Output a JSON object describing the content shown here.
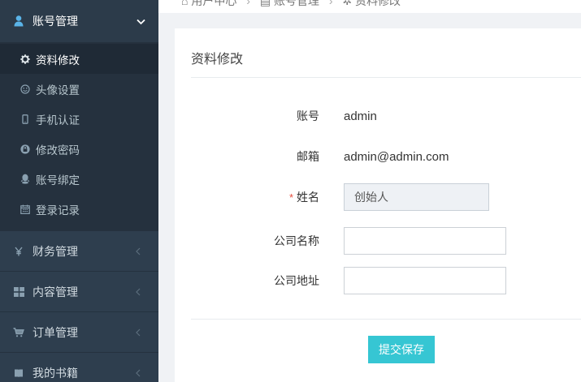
{
  "breadcrumb": {
    "items": [
      "用户中心",
      "账号管理",
      "资料修改"
    ]
  },
  "sidebar": {
    "account": {
      "label": "账号管理",
      "items": [
        {
          "label": "资料修改",
          "icon": "gear-icon",
          "active": true
        },
        {
          "label": "头像设置",
          "icon": "smile-icon"
        },
        {
          "label": "手机认证",
          "icon": "mobile-icon"
        },
        {
          "label": "修改密码",
          "icon": "lock-icon"
        },
        {
          "label": "账号绑定",
          "icon": "qq-icon"
        },
        {
          "label": "登录记录",
          "icon": "calendar-icon"
        }
      ]
    },
    "menus": [
      {
        "label": "财务管理",
        "icon": "yen-icon"
      },
      {
        "label": "内容管理",
        "icon": "grid-icon"
      },
      {
        "label": "订单管理",
        "icon": "cart-icon"
      },
      {
        "label": "我的书籍",
        "icon": "book-icon"
      }
    ]
  },
  "panel": {
    "title": "资料修改",
    "account_label": "账号",
    "account_value": "admin",
    "email_label": "邮箱",
    "email_value": "admin@admin.com",
    "name_label": "姓名",
    "name_required_mark": "*",
    "name_value": "创始人",
    "company_label": "公司名称",
    "company_value": "",
    "address_label": "公司地址",
    "address_value": "",
    "submit_label": "提交保存"
  },
  "colors": {
    "sidebar": "#2e3e4e",
    "accent": "#36c6d3",
    "required": "#e74c3c"
  }
}
